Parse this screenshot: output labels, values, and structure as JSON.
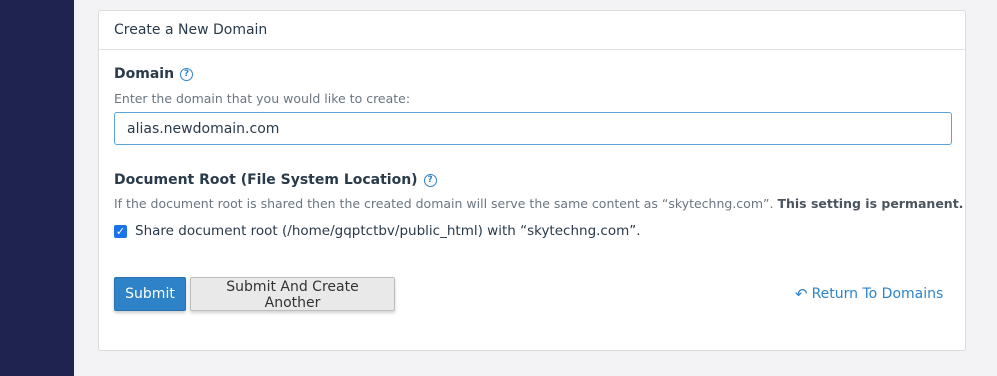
{
  "panel": {
    "title": "Create a New Domain"
  },
  "domain": {
    "label": "Domain",
    "help_icon": "question-circle-icon",
    "hint": "Enter the domain that you would like to create:",
    "value": "alias.newdomain.com"
  },
  "docroot": {
    "label": "Document Root (File System Location)",
    "help_icon": "question-circle-icon",
    "hint_text": "If the document root is shared then the created domain will serve the same content as “skytechng.com”.",
    "hint_strong": "This setting is permanent.",
    "share_checked": true,
    "share_label": "Share document root (/home/gqptctbv/public_html) with “skytechng.com”."
  },
  "actions": {
    "submit_label": "Submit",
    "submit_another_label": "Submit And Create Another",
    "return_label": "Return To Domains",
    "return_icon": "undo-arrow-icon"
  },
  "colors": {
    "sidebar": "#1f2350",
    "accent": "#2e83c8"
  }
}
